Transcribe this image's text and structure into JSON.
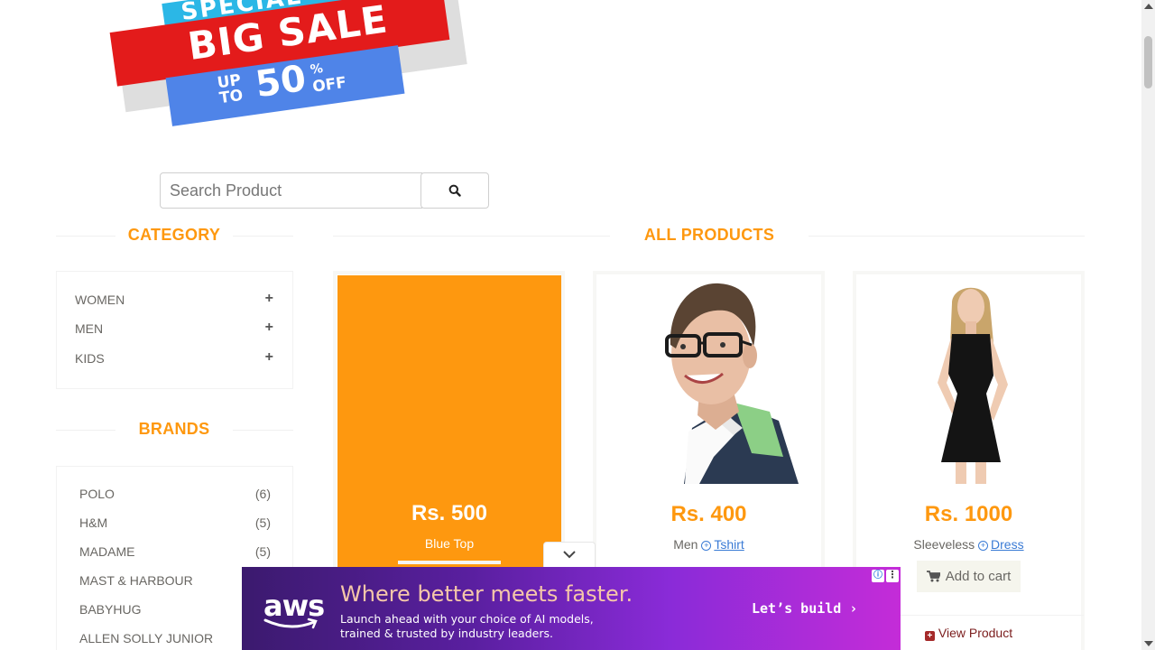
{
  "banner": {
    "top_text": "SPECIAL",
    "main_text": "BIG SALE",
    "up_to": "UP TO",
    "up": "UP",
    "to": "TO",
    "percent": "50",
    "percent_sign": "%",
    "off": "OFF"
  },
  "search": {
    "placeholder": "Search Product",
    "button_icon": "search-icon"
  },
  "sidebar": {
    "category_title": "CATEGORY",
    "categories": [
      {
        "label": "WOMEN",
        "icon": "plus-icon"
      },
      {
        "label": "MEN",
        "icon": "plus-icon"
      },
      {
        "label": "KIDS",
        "icon": "plus-icon"
      }
    ],
    "brands_title": "BRANDS",
    "brands": [
      {
        "name": "POLO",
        "count": "(6)"
      },
      {
        "name": "H&M",
        "count": "(5)"
      },
      {
        "name": "MADAME",
        "count": "(5)"
      },
      {
        "name": "MAST & HARBOUR",
        "count": ""
      },
      {
        "name": "BABYHUG",
        "count": ""
      },
      {
        "name": "ALLEN SOLLY JUNIOR",
        "count": ""
      }
    ]
  },
  "main": {
    "title": "ALL PRODUCTS",
    "products": [
      {
        "price": "Rs. 500",
        "name": "Blue Top",
        "image": "product-image-hidden",
        "state": "hover-overlay"
      },
      {
        "price": "Rs. 400",
        "name_prefix": "Men",
        "name_link": "Tshirt",
        "image": "man-in-polo-photo"
      },
      {
        "price": "Rs. 1000",
        "name_prefix": "Sleeveless",
        "name_link": "Dress",
        "image": "woman-in-black-dress-photo",
        "add_to_cart": "Add to cart",
        "view_product": "View Product"
      }
    ]
  },
  "ad": {
    "brand": "aws",
    "headline": "Where better meets faster.",
    "sub_line1": "Launch ahead with your choice of AI models,",
    "sub_line2": "trained & trusted by industry leaders.",
    "cta": "Let’s build ›",
    "info_icon": "ⓘ",
    "menu_icon": "⋮",
    "collapse_icon": "chevron-down-icon"
  },
  "colors": {
    "accent": "#FE980F",
    "cart_bg": "#F5F5ED",
    "link_blue": "#3a7bd5"
  }
}
